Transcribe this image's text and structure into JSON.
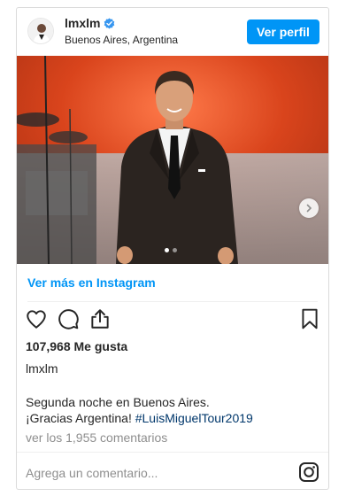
{
  "post": {
    "username": "lmxlm",
    "location": "Buenos Aires, Argentina",
    "profile_button": "Ver perfil",
    "view_more": "Ver más en Instagram",
    "likes": "107,968 Me gusta",
    "caption_user": "lmxlm",
    "caption_line1": "Segunda noche en Buenos Aires.",
    "caption_line2": "¡Gracias Argentina! ",
    "hashtag": "#LuisMiguelTour2019",
    "comments_link": "ver los 1,955 comentarios",
    "comment_placeholder": "Agrega un comentario..."
  },
  "carousel": {
    "current_slide": 1,
    "total_slides": 2
  },
  "icons": {
    "verified": "verified-badge-icon",
    "next": "chevron-right-icon",
    "like": "heart-icon",
    "comment": "comment-bubble-icon",
    "share": "share-icon",
    "save": "bookmark-icon",
    "instagram": "instagram-logo-icon"
  },
  "colors": {
    "accent": "#0095f6",
    "hashtag": "#00376b",
    "muted": "#8e8e8e",
    "text": "#262626"
  }
}
